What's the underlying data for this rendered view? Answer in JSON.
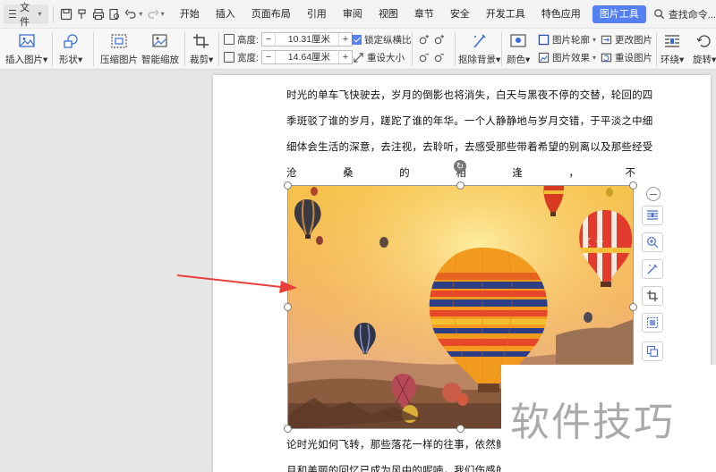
{
  "menubar": {
    "file_label": "文件",
    "tabs": [
      "开始",
      "插入",
      "页面布局",
      "引用",
      "审阅",
      "视图",
      "章节",
      "安全",
      "开发工具",
      "特色应用",
      "图片工具"
    ],
    "active_tab": "图片工具",
    "search_label": "查找命令..."
  },
  "ribbon": {
    "insert_image": "插入图片",
    "shape": "形状",
    "compress": "压缩图片",
    "smart_zoom": "智能缩放",
    "crop": "裁剪",
    "height_label": "高度:",
    "height_value": "10.31厘米",
    "width_label": "宽度:",
    "width_value": "14.64厘米",
    "lock_ratio": "锁定纵横比",
    "reset_size": "重设大小",
    "remove_bg": "抠除背景",
    "color": "颜色",
    "image_outline": "图片轮廓",
    "image_effect": "图片效果",
    "change_image": "更改图片",
    "reset_image": "重设图片",
    "wrap": "环绕",
    "rotate": "旋转"
  },
  "document": {
    "line1": "时光的单车飞快驶去，岁月的倒影也将消失，白天与黑夜不停的交替，轮回的四",
    "line2": "季斑驳了谁的岁月，蹉跎了谁的年华。一个人静静地与岁月交错，于平淡之中细",
    "line3": "细体会生活的深意，去注视，去聆听，去感受那些带着希望的别离以及那些经受",
    "line4_chars": [
      "沧",
      "桑",
      "的",
      "相",
      "逢",
      "，",
      "不"
    ],
    "line5": "论时光如何飞转，那些落花一样的往事，依然鲜活",
    "line6": "月和美丽的回忆已成为风中的呢喃，我们伤感的"
  },
  "image": {
    "description_label": "hot-air-balloons-photo"
  },
  "watermark": "软件技巧",
  "colors": {
    "accent": "#5580f1",
    "arrow": "#e8413a"
  }
}
